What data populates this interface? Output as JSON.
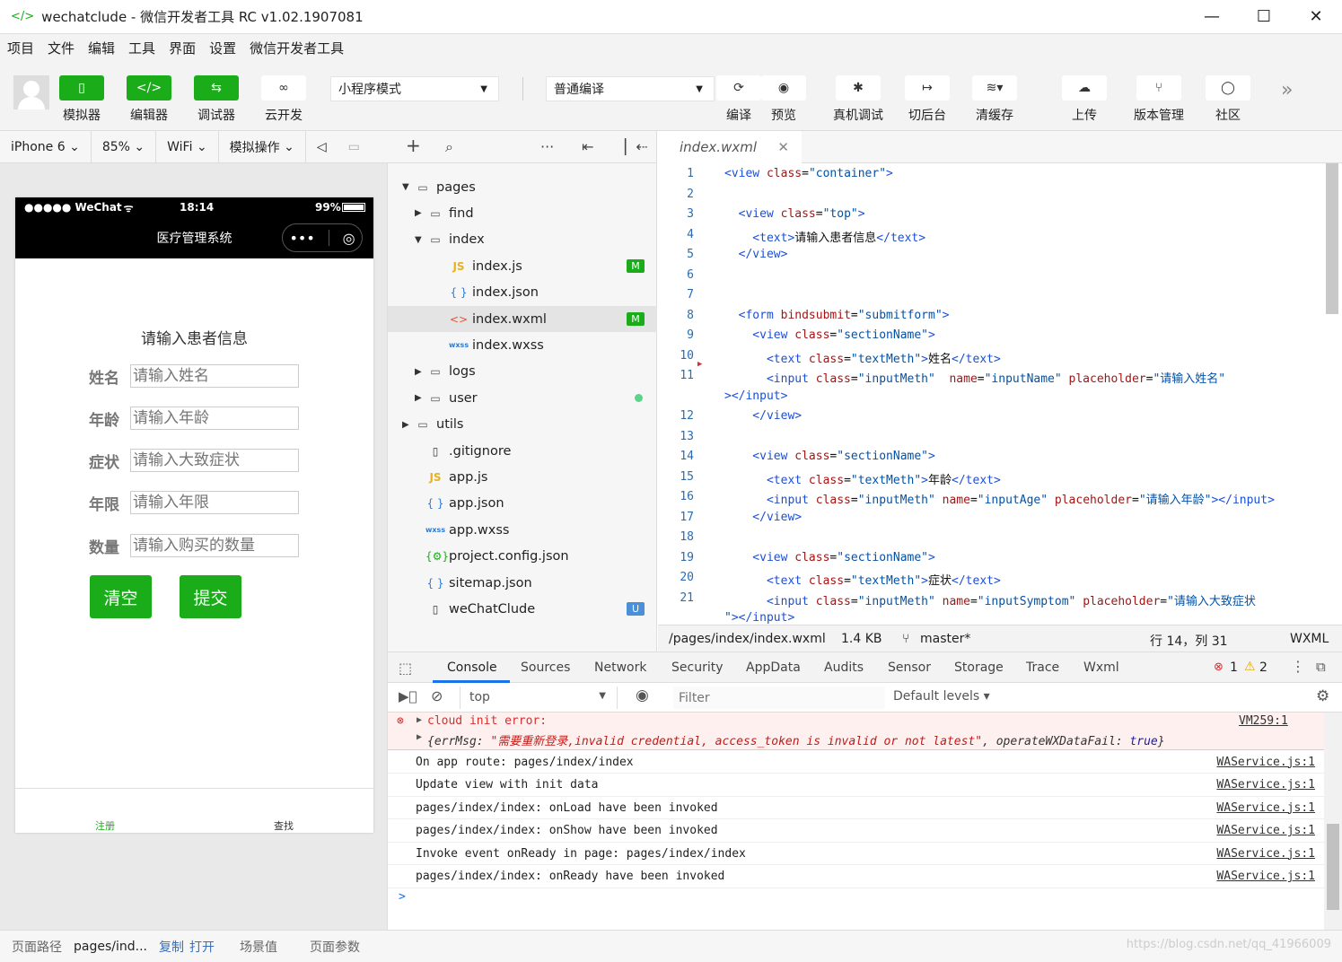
{
  "window": {
    "title": "wechatclude - 微信开发者工具 RC v1.02.1907081",
    "logo": "</>",
    "controls": [
      "—",
      "☐",
      "✕"
    ]
  },
  "menu": [
    "项目",
    "文件",
    "编辑",
    "工具",
    "界面",
    "设置",
    "微信开发者工具"
  ],
  "toolbar": {
    "left_buttons": [
      {
        "label": "模拟器",
        "icon": "phone-icon"
      },
      {
        "label": "编辑器",
        "icon": "code-icon"
      },
      {
        "label": "调试器",
        "icon": "debug-icon"
      },
      {
        "label": "云开发",
        "icon": "cloud-icon"
      }
    ],
    "mode_select": "小程序模式",
    "compile_select": "普通编译",
    "right_buttons": [
      {
        "label": "编译",
        "icon": "refresh-icon"
      },
      {
        "label": "预览",
        "icon": "eye-icon"
      },
      {
        "label": "真机调试",
        "icon": "bug-icon"
      },
      {
        "label": "切后台",
        "icon": "switch-icon"
      },
      {
        "label": "清缓存",
        "icon": "layers-icon"
      },
      {
        "label": "上传",
        "icon": "upload-icon"
      },
      {
        "label": "版本管理",
        "icon": "branch-icon"
      },
      {
        "label": "社区",
        "icon": "chat-icon"
      }
    ],
    "more": "»"
  },
  "simbar": {
    "device": "iPhone 6",
    "zoom": "85%",
    "network": "WiFi",
    "ops": "模拟操作"
  },
  "phone": {
    "carrier": "●●●●● WeChat",
    "time": "18:14",
    "battery": "99%",
    "nav_title": "医疗管理系统",
    "heading": "请输入患者信息",
    "fields": [
      {
        "label": "姓名",
        "placeholder": "请输入姓名"
      },
      {
        "label": "年龄",
        "placeholder": "请输入年龄"
      },
      {
        "label": "症状",
        "placeholder": "请输入大致症状"
      },
      {
        "label": "年限",
        "placeholder": "请输入年限"
      },
      {
        "label": "数量",
        "placeholder": "请输入购买的数量"
      }
    ],
    "clear_btn": "清空",
    "submit_btn": "提交",
    "tabs": [
      "注册",
      "查找"
    ],
    "tab_active_color": "#1aad19"
  },
  "simfooter": {
    "path_label": "页面路径",
    "path": "pages/ind...",
    "copy": "复制",
    "open": "打开",
    "scene": "场景值",
    "params": "页面参数"
  },
  "tree": [
    {
      "name": "pages",
      "type": "folder",
      "open": true,
      "level": 0
    },
    {
      "name": "find",
      "type": "folder",
      "open": false,
      "level": 1
    },
    {
      "name": "index",
      "type": "folder",
      "open": true,
      "level": 1
    },
    {
      "name": "index.js",
      "type": "js",
      "level": 2,
      "badge": "M"
    },
    {
      "name": "index.json",
      "type": "json",
      "level": 2
    },
    {
      "name": "index.wxml",
      "type": "wxml",
      "level": 2,
      "badge": "M",
      "selected": true
    },
    {
      "name": "index.wxss",
      "type": "wxss",
      "level": 2
    },
    {
      "name": "logs",
      "type": "folder",
      "open": false,
      "level": 1
    },
    {
      "name": "user",
      "type": "folder",
      "open": false,
      "level": 1,
      "dot": true
    },
    {
      "name": "utils",
      "type": "folder",
      "open": false,
      "level": 0
    },
    {
      "name": ".gitignore",
      "type": "file",
      "level": 0
    },
    {
      "name": "app.js",
      "type": "js",
      "level": 0
    },
    {
      "name": "app.json",
      "type": "json",
      "level": 0
    },
    {
      "name": "app.wxss",
      "type": "wxss",
      "level": 0
    },
    {
      "name": "project.config.json",
      "type": "config",
      "level": 0
    },
    {
      "name": "sitemap.json",
      "type": "json",
      "level": 0
    },
    {
      "name": "weChatClude",
      "type": "file",
      "level": 0,
      "badge": "U"
    }
  ],
  "editor": {
    "tab": "index.wxml",
    "lines": [
      {
        "n": "1",
        "code": [
          [
            "t",
            "<view "
          ],
          [
            "a",
            "class"
          ],
          [
            "x",
            "="
          ],
          [
            "v",
            "\"container\""
          ],
          [
            "t",
            ">"
          ]
        ]
      },
      {
        "n": "2",
        "code": []
      },
      {
        "n": "3",
        "code": [
          [
            "t",
            "  <view "
          ],
          [
            "a",
            "class"
          ],
          [
            "x",
            "="
          ],
          [
            "v",
            "\"top\""
          ],
          [
            "t",
            ">"
          ]
        ]
      },
      {
        "n": "4",
        "code": [
          [
            "t",
            "    <text>"
          ],
          [
            "x",
            "请输入患者信息"
          ],
          [
            "t",
            "</text>"
          ]
        ]
      },
      {
        "n": "5",
        "code": [
          [
            "t",
            "  </view>"
          ]
        ]
      },
      {
        "n": "6",
        "code": []
      },
      {
        "n": "7",
        "code": []
      },
      {
        "n": "8",
        "code": [
          [
            "t",
            "  <form "
          ],
          [
            "a",
            "bindsubmit"
          ],
          [
            "x",
            "="
          ],
          [
            "v",
            "\"submitform\""
          ],
          [
            "t",
            ">"
          ]
        ]
      },
      {
        "n": "9",
        "code": [
          [
            "t",
            "    <view "
          ],
          [
            "a",
            "class"
          ],
          [
            "x",
            "="
          ],
          [
            "v",
            "\"sectionName\""
          ],
          [
            "t",
            ">"
          ]
        ]
      },
      {
        "n": "10",
        "code": [
          [
            "t",
            "      <text "
          ],
          [
            "a",
            "class"
          ],
          [
            "x",
            "="
          ],
          [
            "v",
            "\"textMeth\""
          ],
          [
            "t",
            ">"
          ],
          [
            "x",
            "姓名"
          ],
          [
            "t",
            "</text>"
          ]
        ]
      },
      {
        "n": "11",
        "code": [
          [
            "t",
            "      <input "
          ],
          [
            "a",
            "class"
          ],
          [
            "x",
            "="
          ],
          [
            "v",
            "\"inputMeth\""
          ],
          [
            "x",
            "  "
          ],
          [
            "a",
            "name"
          ],
          [
            "x",
            "="
          ],
          [
            "v",
            "\"inputName\""
          ],
          [
            "x",
            " "
          ],
          [
            "a",
            "placeholder"
          ],
          [
            "x",
            "="
          ],
          [
            "v",
            "\"请输入姓名\""
          ]
        ]
      },
      {
        "n": "",
        "code": [
          [
            "t",
            "></input>"
          ]
        ]
      },
      {
        "n": "12",
        "code": [
          [
            "t",
            "    </view>"
          ]
        ]
      },
      {
        "n": "13",
        "code": []
      },
      {
        "n": "14",
        "code": [
          [
            "t",
            "    <view "
          ],
          [
            "a",
            "class"
          ],
          [
            "x",
            "="
          ],
          [
            "v",
            "\"sectionName\""
          ],
          [
            "t",
            ">"
          ]
        ]
      },
      {
        "n": "15",
        "code": [
          [
            "t",
            "      <text "
          ],
          [
            "a",
            "class"
          ],
          [
            "x",
            "="
          ],
          [
            "v",
            "\"textMeth\""
          ],
          [
            "t",
            ">"
          ],
          [
            "x",
            "年龄"
          ],
          [
            "t",
            "</text>"
          ]
        ]
      },
      {
        "n": "16",
        "code": [
          [
            "t",
            "      <input "
          ],
          [
            "a",
            "class"
          ],
          [
            "x",
            "="
          ],
          [
            "v",
            "\"inputMeth\""
          ],
          [
            "x",
            " "
          ],
          [
            "a",
            "name"
          ],
          [
            "x",
            "="
          ],
          [
            "v",
            "\"inputAge\""
          ],
          [
            "x",
            " "
          ],
          [
            "a",
            "placeholder"
          ],
          [
            "x",
            "="
          ],
          [
            "v",
            "\"请输入年龄\""
          ],
          [
            "t",
            "></input>"
          ]
        ]
      },
      {
        "n": "17",
        "code": [
          [
            "t",
            "    </view>"
          ]
        ]
      },
      {
        "n": "18",
        "code": []
      },
      {
        "n": "19",
        "code": [
          [
            "t",
            "    <view "
          ],
          [
            "a",
            "class"
          ],
          [
            "x",
            "="
          ],
          [
            "v",
            "\"sectionName\""
          ],
          [
            "t",
            ">"
          ]
        ]
      },
      {
        "n": "20",
        "code": [
          [
            "t",
            "      <text "
          ],
          [
            "a",
            "class"
          ],
          [
            "x",
            "="
          ],
          [
            "v",
            "\"textMeth\""
          ],
          [
            "t",
            ">"
          ],
          [
            "x",
            "症状"
          ],
          [
            "t",
            "</text>"
          ]
        ]
      },
      {
        "n": "21",
        "code": [
          [
            "t",
            "      <input "
          ],
          [
            "a",
            "class"
          ],
          [
            "x",
            "="
          ],
          [
            "v",
            "\"inputMeth\""
          ],
          [
            "x",
            " "
          ],
          [
            "a",
            "name"
          ],
          [
            "x",
            "="
          ],
          [
            "v",
            "\"inputSymptom\""
          ],
          [
            "x",
            " "
          ],
          [
            "a",
            "placeholder"
          ],
          [
            "x",
            "="
          ],
          [
            "v",
            "\"请输入大致症状"
          ]
        ]
      },
      {
        "n": "",
        "code": [
          [
            "v",
            "\""
          ],
          [
            "t",
            "></input>"
          ]
        ]
      }
    ]
  },
  "edstatus": {
    "path": "/pages/index/index.wxml",
    "size": "1.4 KB",
    "branch": "master*",
    "position": "行 14，列 31",
    "lang": "WXML"
  },
  "devtools": {
    "tabs": [
      "Console",
      "Sources",
      "Network",
      "Security",
      "AppData",
      "Audits",
      "Sensor",
      "Storage",
      "Trace",
      "Wxml"
    ],
    "active_tab": "Console",
    "errors": "1",
    "warnings": "2",
    "context": "top",
    "filter_placeholder": "Filter",
    "levels": "Default levels",
    "error_line1": "cloud init error:",
    "error_src": "VM259:1",
    "error_obj_key": "errMsg",
    "error_obj_msg": "\"需要重新登录,invalid credential, access_token is invalid or not latest\"",
    "error_obj_key2": "operateWXDataFail",
    "error_obj_val2": "true",
    "logs": [
      {
        "text": "On app route: pages/index/index",
        "src": "WAService.js:1"
      },
      {
        "text": "Update view with init data",
        "src": "WAService.js:1"
      },
      {
        "text": "pages/index/index: onLoad have been invoked",
        "src": "WAService.js:1"
      },
      {
        "text": "pages/index/index: onShow have been invoked",
        "src": "WAService.js:1"
      },
      {
        "text": "Invoke event onReady in page: pages/index/index",
        "src": "WAService.js:1"
      },
      {
        "text": "pages/index/index: onReady have been invoked",
        "src": "WAService.js:1"
      }
    ],
    "prompt": ">"
  },
  "watermark": "https://blog.csdn.net/qq_41966009",
  "colors": {
    "accent": "#1aad19",
    "error": "#d32f2f",
    "badge_m": "#1aad19",
    "badge_u": "#4a90d9"
  }
}
